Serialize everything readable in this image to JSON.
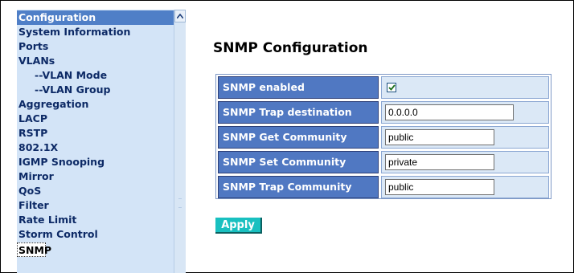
{
  "sidebar": {
    "header": "Configuration",
    "items": [
      {
        "label": "System Information"
      },
      {
        "label": "Ports"
      },
      {
        "label": "VLANs"
      },
      {
        "label": "--VLAN Mode"
      },
      {
        "label": "--VLAN Group"
      },
      {
        "label": "Aggregation"
      },
      {
        "label": "LACP"
      },
      {
        "label": "RSTP"
      },
      {
        "label": "802.1X"
      },
      {
        "label": "IGMP Snooping"
      },
      {
        "label": "Mirror"
      },
      {
        "label": "QoS"
      },
      {
        "label": "Filter"
      },
      {
        "label": "Rate Limit"
      },
      {
        "label": "Storm Control"
      },
      {
        "label": "SNMP"
      }
    ]
  },
  "main": {
    "title": "SNMP Configuration",
    "fields": [
      {
        "label": "SNMP enabled",
        "checked": true
      },
      {
        "label": "SNMP Trap destination",
        "value": "0.0.0.0"
      },
      {
        "label": "SNMP Get Community",
        "value": "public"
      },
      {
        "label": "SNMP Set Community",
        "value": "private"
      },
      {
        "label": "SNMP Trap Community",
        "value": "public"
      }
    ],
    "apply_label": "Apply"
  },
  "colors": {
    "sidebar_bg": "#d3e4f7",
    "header_bg": "#4f7fc7",
    "label_bg": "#5078c2",
    "value_bg": "#dbe8f6",
    "apply_bg": "#19c0c0"
  }
}
